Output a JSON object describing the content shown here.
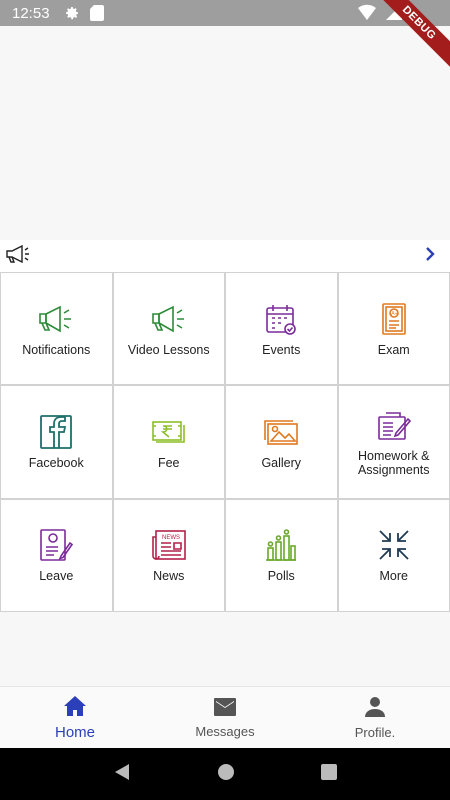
{
  "status_bar": {
    "time": "12:53"
  },
  "debug_banner": "DEBUG",
  "colors": {
    "accent": "#2b3fb8",
    "green": "#2e8b3a",
    "purple": "#7a2b9a",
    "orange": "#e07a20",
    "teal": "#1f6f6a"
  },
  "grid": {
    "tiles": [
      {
        "label": "Notifications",
        "icon": "megaphone-icon"
      },
      {
        "label": "Video Lessons",
        "icon": "megaphone-icon"
      },
      {
        "label": "Events",
        "icon": "calendar-icon"
      },
      {
        "label": "Exam",
        "icon": "exam-sheet-icon"
      },
      {
        "label": "Facebook",
        "icon": "facebook-icon"
      },
      {
        "label": "Fee",
        "icon": "rupee-cash-icon"
      },
      {
        "label": "Gallery",
        "icon": "gallery-icon"
      },
      {
        "label": "Homework & Assignments",
        "icon": "homework-icon"
      },
      {
        "label": "Leave",
        "icon": "leave-form-icon"
      },
      {
        "label": "News",
        "icon": "newspaper-icon"
      },
      {
        "label": "Polls",
        "icon": "poll-bars-icon"
      },
      {
        "label": "More",
        "icon": "collapse-arrows-icon"
      }
    ]
  },
  "bottom_nav": {
    "items": [
      {
        "label": "Home",
        "icon": "home-icon",
        "active": true
      },
      {
        "label": "Messages",
        "icon": "mail-icon",
        "active": false
      },
      {
        "label": "Profile.",
        "icon": "person-icon",
        "active": false
      }
    ]
  }
}
